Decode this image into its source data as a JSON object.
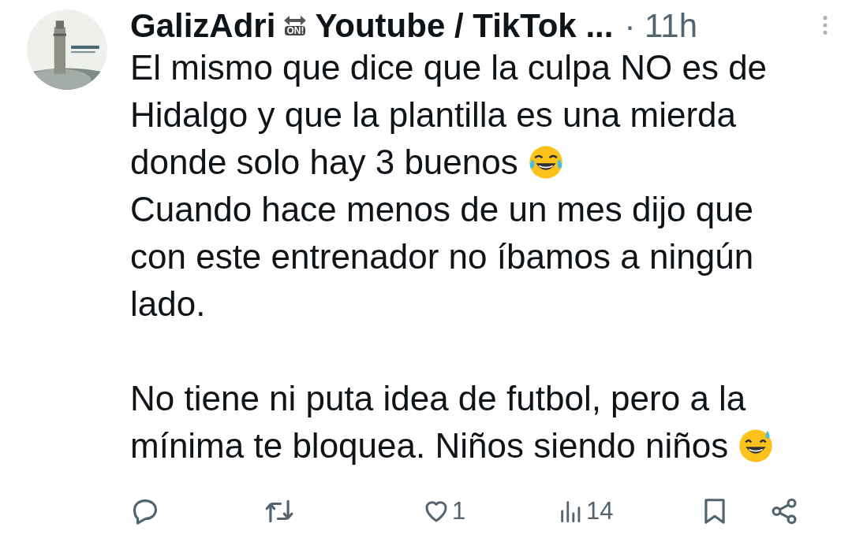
{
  "author": {
    "name": "GalizAdri",
    "badge": "ON!",
    "rest": "Youtube / TikTok ...",
    "time": "· 11h"
  },
  "lines": [
    {
      "text": "El mismo que dice que la culpa NO es de",
      "kind": "plain"
    },
    {
      "text": "Hidalgo y que la plantilla es una mierda",
      "kind": "plain"
    },
    {
      "text": "donde solo hay 3 buenos",
      "kind": "joy"
    },
    {
      "text": "Cuando hace menos de un mes dijo que",
      "kind": "plain"
    },
    {
      "text": "con este entrenador no íbamos a ningún",
      "kind": "plain"
    },
    {
      "text": "lado.",
      "kind": "plain"
    },
    {
      "text": "No tiene ni puta idea de futbol, pero a la",
      "kind": "after_gap"
    },
    {
      "text": "mínima te bloquea. Niños siendo niños",
      "kind": "sweat"
    }
  ],
  "actions": [
    {
      "kind": "reply"
    },
    {
      "kind": "repost"
    },
    {
      "kind": "like",
      "count": "1"
    },
    {
      "kind": "views",
      "count": "14"
    },
    {
      "kind": "bookmark"
    },
    {
      "kind": "share"
    }
  ]
}
